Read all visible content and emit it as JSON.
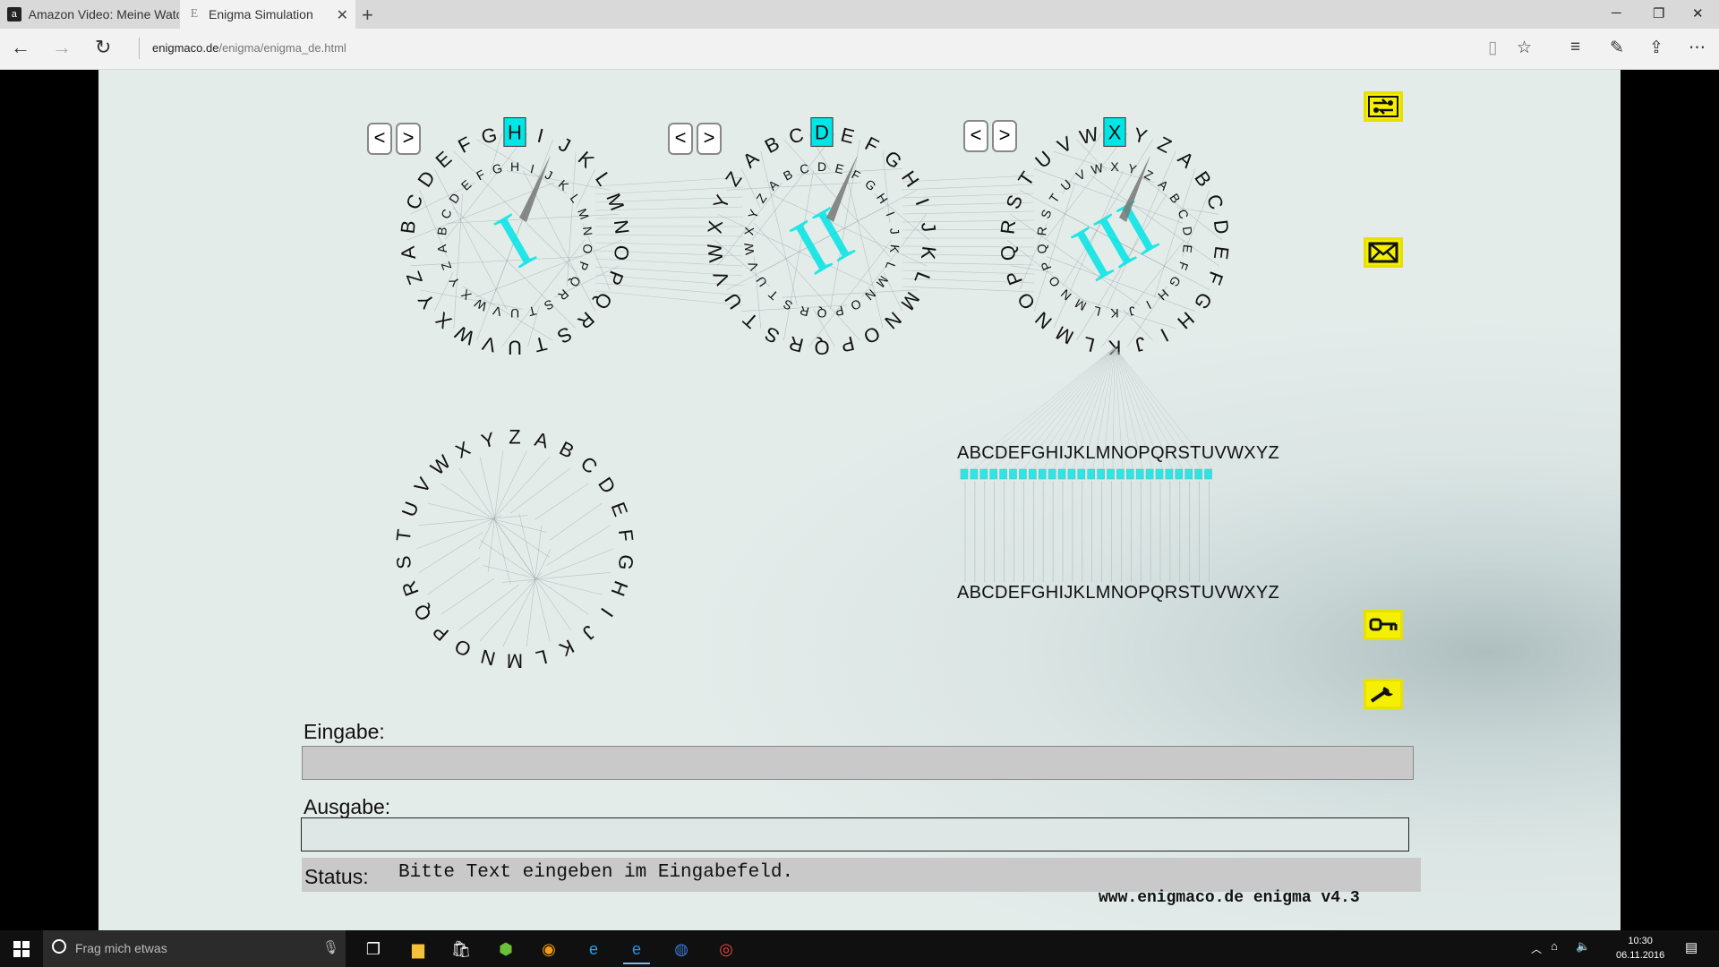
{
  "browser": {
    "tabs": [
      {
        "label": "Amazon Video: Meine Watc",
        "icon": "amazon-icon"
      },
      {
        "label": "Enigma Simulation",
        "icon": "page-icon",
        "active": true
      }
    ],
    "new_tab": "+",
    "url_domain": "enigmaco.de",
    "url_path": "/enigma/enigma_de.html"
  },
  "rotors": {
    "alphabet": "ABCDEFGHIJKLMNOPQRSTUVWXYZ",
    "left": {
      "numeral": "I",
      "position": "H"
    },
    "middle": {
      "numeral": "II",
      "position": "D"
    },
    "right": {
      "numeral": "III",
      "position": "X"
    },
    "prev_label": "<",
    "next_label": ">",
    "accent_color": "#00e5e5"
  },
  "plugboard": {
    "top_alphabet": "ABCDEFGHIJKLMNOPQRSTUVWXYZ",
    "bottom_alphabet": "ABCDEFGHIJKLMNOPQRSTUVWXYZ"
  },
  "side_buttons": [
    "swap-icon",
    "envelope-icon",
    "key-icon",
    "wrench-icon"
  ],
  "io": {
    "input_label": "Eingabe:",
    "input_value": "",
    "output_label": "Ausgabe:",
    "output_value": "",
    "status_label": "Status:",
    "status_text": "Bitte Text eingeben im Eingabefeld."
  },
  "footer": "www.enigmaco.de enigma v4.3",
  "taskbar": {
    "search_placeholder": "Frag mich etwas",
    "time": "10:30",
    "date": "06.11.2016"
  }
}
